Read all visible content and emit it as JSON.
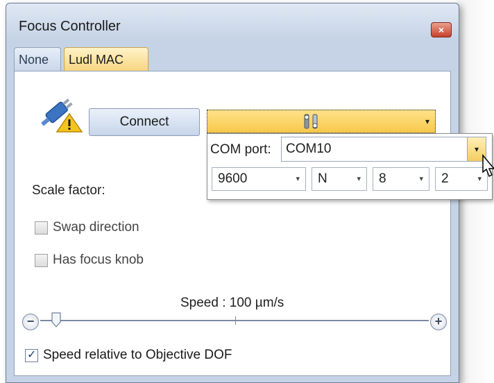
{
  "window": {
    "title": "Focus Controller",
    "close_glyph": "×"
  },
  "tabs": [
    {
      "label": "None"
    },
    {
      "label": "Ludl MAC"
    }
  ],
  "connection": {
    "connect_label": "Connect",
    "status_icon": "plug-warning-icon",
    "port_combo_icon": "tools-icon"
  },
  "port_dropdown": {
    "com_label": "COM port:",
    "com_value": "COM10",
    "baud": "9600",
    "parity": "N",
    "data_bits": "8",
    "stop_bits": "2",
    "arrow_glyph": "▾"
  },
  "settings": {
    "scale_label": "Scale factor:",
    "swap_label": "Swap direction",
    "knob_label": "Has focus knob",
    "speed_label": "Speed : 100 µm/s",
    "dof_label": "Speed relative to Objective DOF"
  },
  "colors": {
    "accent": "#f8c84a",
    "window_frame": "#c6d3e6"
  }
}
